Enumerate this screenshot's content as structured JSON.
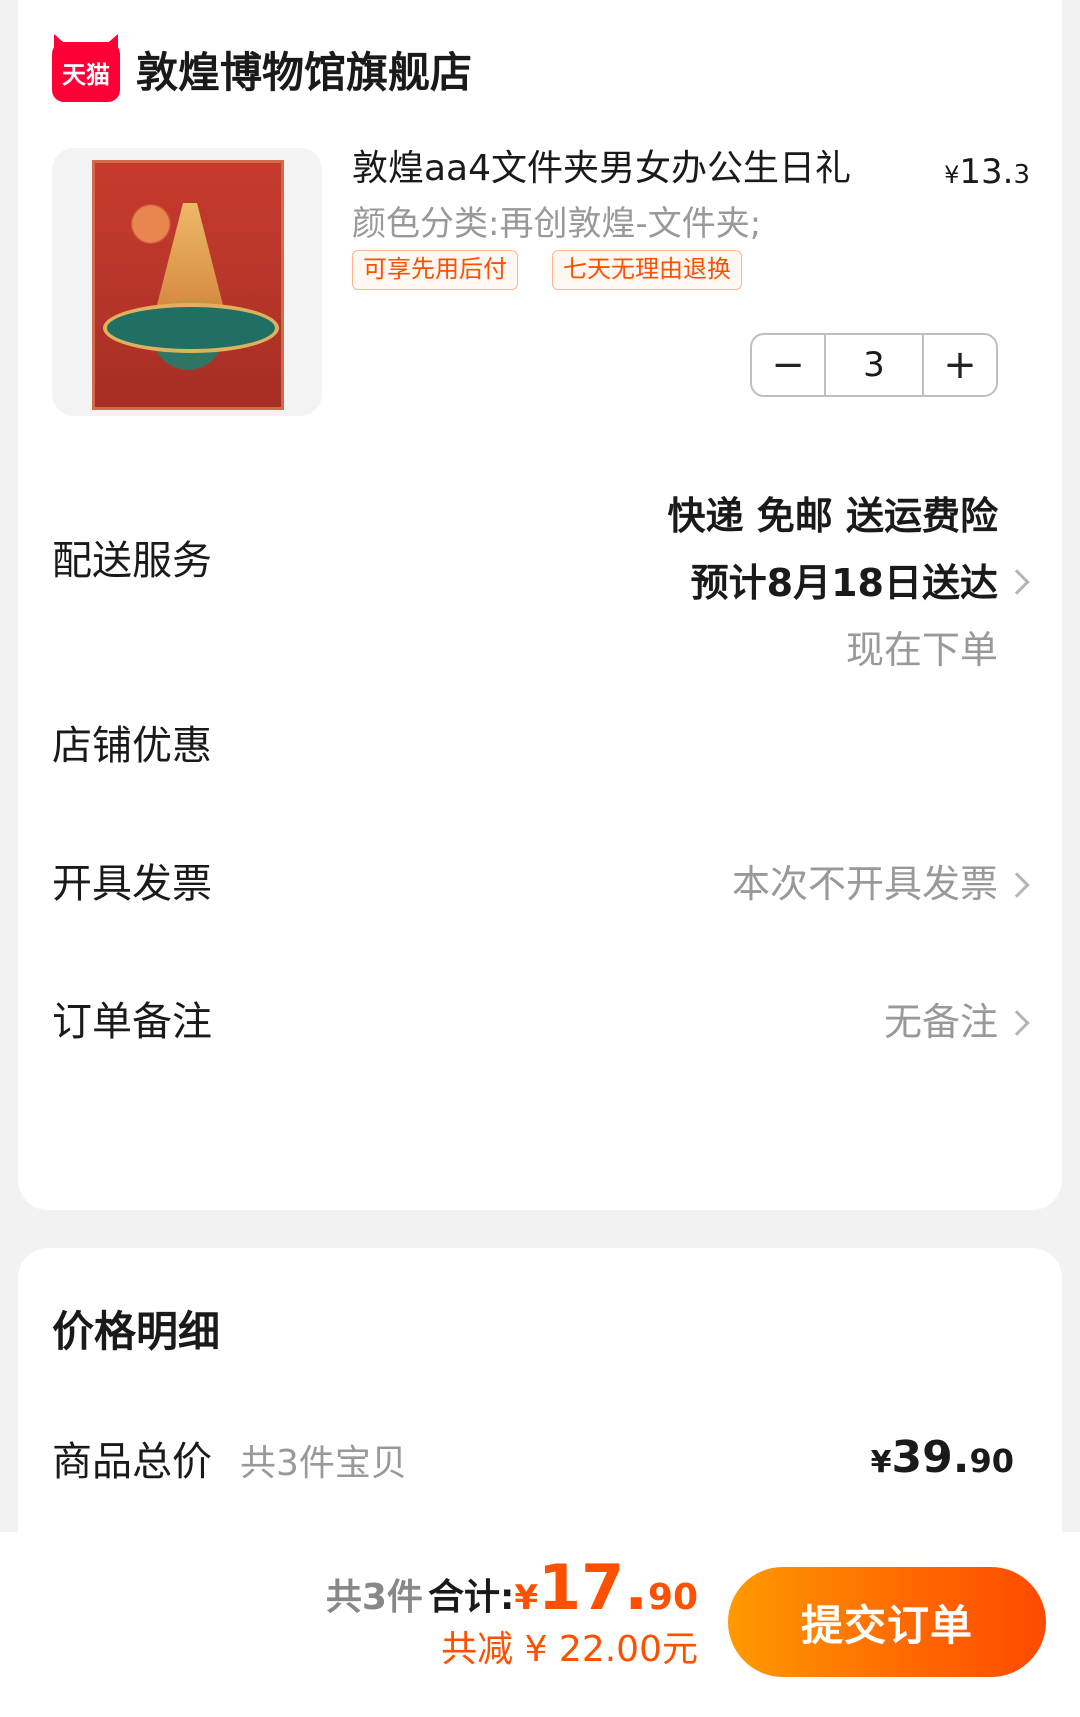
{
  "store": {
    "badge": "天猫",
    "name": "敦煌博物馆旗舰店"
  },
  "product": {
    "title": "敦煌aa4文件夹男女办公生日礼",
    "price_yen": "¥",
    "price_int": "13.",
    "price_dec": "3",
    "spec": "颜色分类:再创敦煌-文件夹;",
    "tags": [
      "可享先用后付",
      "七天无理由退换"
    ],
    "quantity": "3",
    "minus": "−",
    "plus": "+"
  },
  "delivery": {
    "label": "配送服务",
    "line1": "快递 免邮 送运费险",
    "line2": "预计8月18日送达",
    "line3": "现在下单"
  },
  "store_discount": {
    "label": "店铺优惠"
  },
  "invoice": {
    "label": "开具发票",
    "value": "本次不开具发票"
  },
  "note": {
    "label": "订单备注",
    "value": "无备注"
  },
  "price_detail": {
    "heading": "价格明细",
    "goods_total_label": "商品总价",
    "goods_total_sub": "共3件宝贝",
    "amount_yen": "¥",
    "amount_int": "39.",
    "amount_dec": "90"
  },
  "footer": {
    "count": "共3件",
    "total_label": "合计:",
    "total_yen": "¥",
    "total_int": "17.",
    "total_dec": "90",
    "saved": "共减 ¥ 22.00元",
    "submit": "提交订单"
  },
  "colors": {
    "accent": "#ff5000",
    "tmall_red": "#ff0036"
  }
}
